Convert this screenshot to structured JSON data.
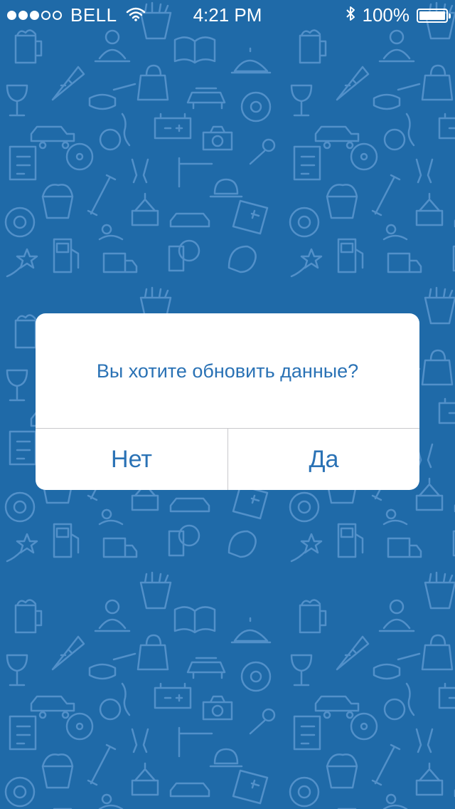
{
  "status_bar": {
    "carrier": "BELL",
    "time": "4:21 PM",
    "battery_percent": "100%",
    "signal_bars_filled": 3,
    "signal_bars_total": 5
  },
  "alert": {
    "message": "Вы хотите обновить данные?",
    "no_label": "Нет",
    "yes_label": "Да"
  },
  "colors": {
    "background": "#1f6aa8",
    "alert_text": "#2a72b5"
  }
}
